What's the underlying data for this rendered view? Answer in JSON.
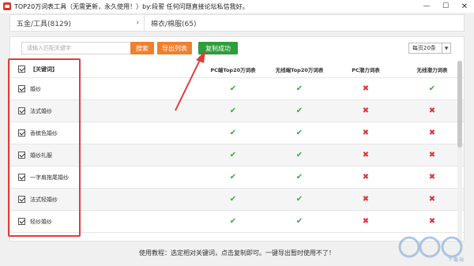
{
  "window": {
    "title": "TOP20万词表工具（无需更新，永久使用！）by:段誓 任何问题直接论坛私信我好。",
    "min": "—",
    "max": "☐",
    "close": "✕"
  },
  "categories": [
    {
      "label": "五金/工具(8129)"
    },
    {
      "label": "棉衣/棉服(65)"
    }
  ],
  "toolbar": {
    "search_placeholder": "请输入匹配关键字",
    "search_label": "搜索",
    "export_label": "导出列表",
    "copy_label": "复制成功",
    "per_page": "每页20条"
  },
  "table": {
    "headers": [
      "【关键词】",
      "PC端Top20万词表",
      "无线端Top20万词表",
      "PC潜力词表",
      "无线潜力词表"
    ],
    "rows": [
      {
        "keyword": "婚纱",
        "marks": [
          "ok",
          "ok",
          "no",
          "ok"
        ]
      },
      {
        "keyword": "法式婚纱",
        "marks": [
          "ok",
          "ok",
          "no",
          "no"
        ]
      },
      {
        "keyword": "香槟色婚纱",
        "marks": [
          "ok",
          "ok",
          "no",
          "no"
        ]
      },
      {
        "keyword": "婚纱礼服",
        "marks": [
          "ok",
          "ok",
          "no",
          "no"
        ]
      },
      {
        "keyword": "一字肩拖尾婚纱",
        "marks": [
          "ok",
          "ok",
          "no",
          "no"
        ]
      },
      {
        "keyword": "法式轻婚纱",
        "marks": [
          "ok",
          "ok",
          "no",
          "no"
        ]
      },
      {
        "keyword": "轻纱婚纱",
        "marks": [
          "ok",
          "ok",
          "no",
          "no"
        ]
      }
    ],
    "ok_glyph": "✔",
    "no_glyph": "✖"
  },
  "footer": {
    "text": "使用教程：选定相对关键词，点击复制即可。一键导出暂时使用不了！"
  },
  "watermark": {
    "text": "下载站",
    "color": "#2f6fc6"
  }
}
